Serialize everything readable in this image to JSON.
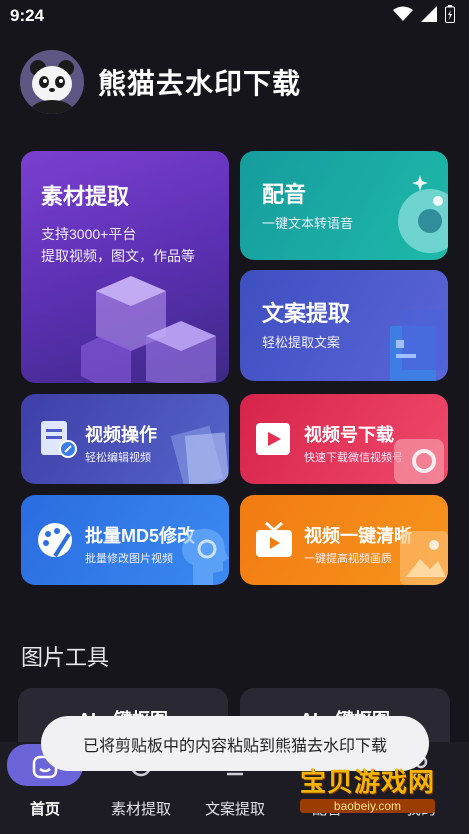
{
  "status": {
    "time": "9:24"
  },
  "app": {
    "title": "熊猫去水印下载"
  },
  "cards": {
    "sucai": {
      "title": "素材提取",
      "line1": "支持3000+平台",
      "line2": "提取视频，图文，作品等"
    },
    "peiyin": {
      "title": "配音",
      "sub": "一键文本转语音"
    },
    "wenan": {
      "title": "文案提取",
      "sub": "轻松提取文案"
    },
    "shipin": {
      "title": "视频操作",
      "sub": "轻松编辑视频"
    },
    "shipinhao": {
      "title": "视频号下载",
      "sub": "快速下载微信视频号"
    },
    "md5": {
      "title": "批量MD5修改",
      "sub": "批量修改图片视频"
    },
    "qingxi": {
      "title": "视频一键清晰",
      "sub": "一键提高视频画质"
    }
  },
  "image_tools": {
    "title": "图片工具",
    "item1": "AI一键抠图",
    "item2": "AI一键抠图"
  },
  "toast": {
    "text": "已将剪贴板中的内容粘贴到熊猫去水印下载"
  },
  "nav": {
    "items": [
      {
        "label": "首页"
      },
      {
        "label": "素材提取"
      },
      {
        "label": "文案提取"
      },
      {
        "label": "配音"
      },
      {
        "label": "我的"
      }
    ]
  },
  "watermark": {
    "name": "宝贝游戏网",
    "url": "baobeiy.com"
  }
}
